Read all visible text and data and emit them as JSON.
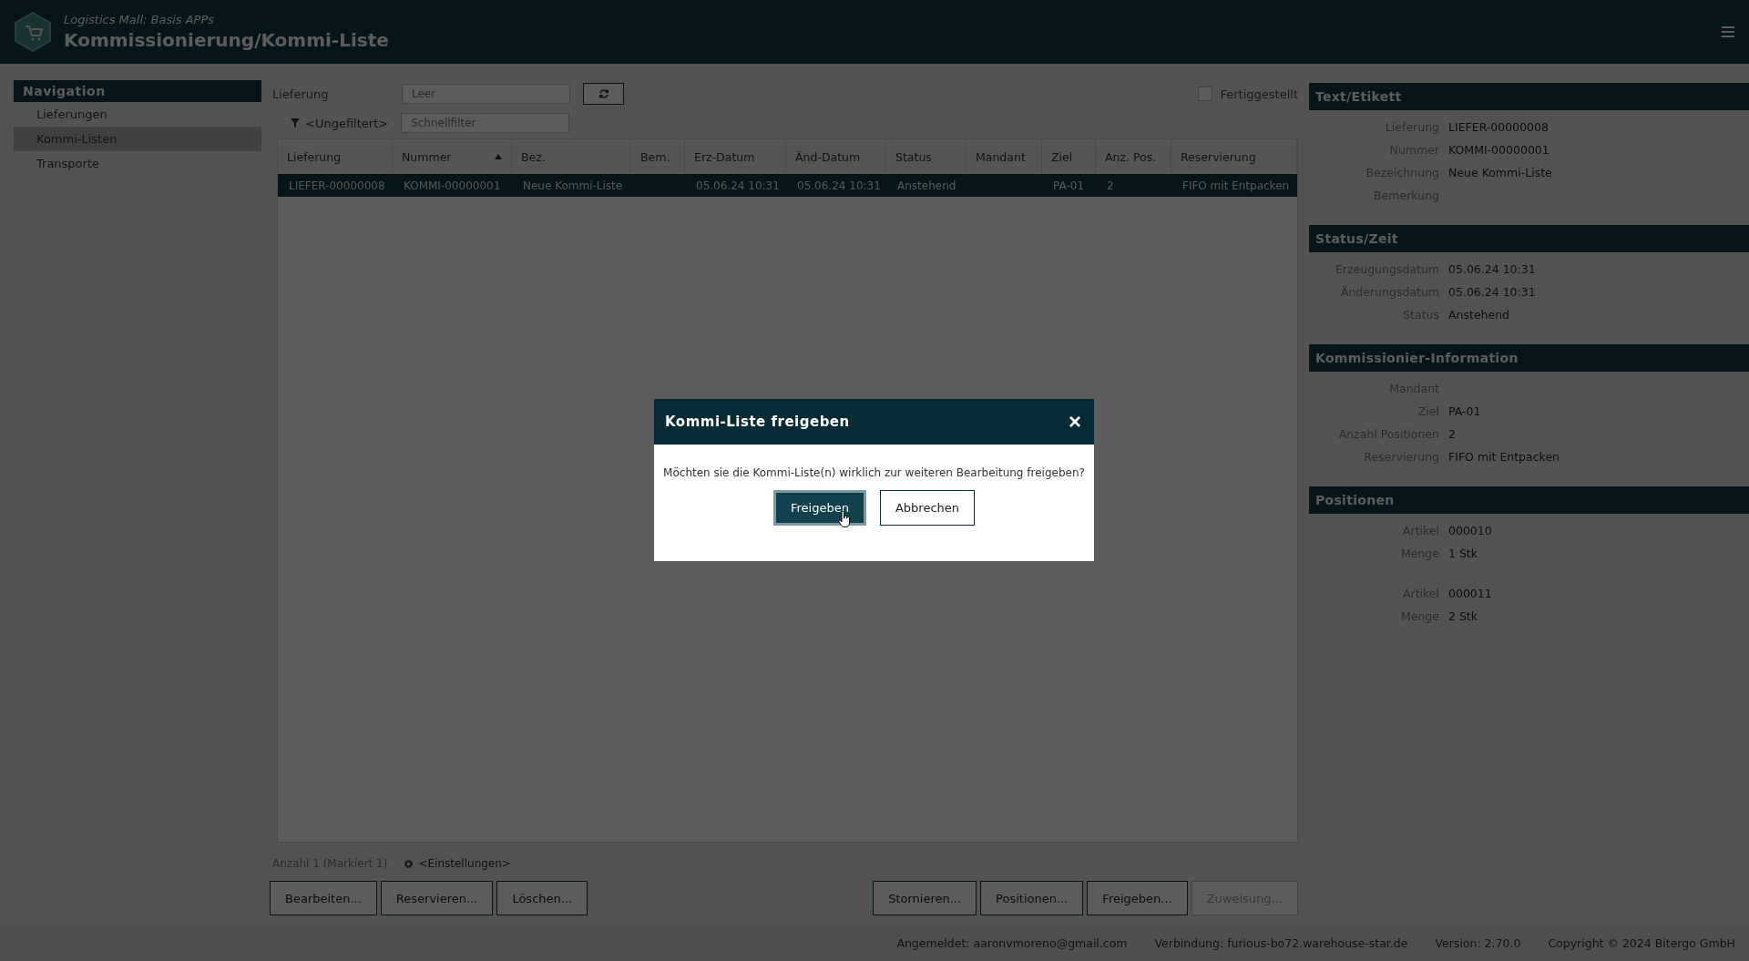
{
  "header": {
    "subtitle": "Logistics Mall: Basis APPs",
    "title": "Kommissionierung/Kommi-Liste"
  },
  "navigation": {
    "title": "Navigation",
    "items": [
      {
        "label": "Lieferungen",
        "selected": false
      },
      {
        "label": "Kommi-Listen",
        "selected": true
      },
      {
        "label": "Transporte",
        "selected": false
      }
    ]
  },
  "delivery_filter": {
    "label": "Lieferung",
    "placeholder": "Leer"
  },
  "finished_checkbox": {
    "label": "Fertiggestellt",
    "checked": false
  },
  "quick_filter": {
    "filter_label": "<Ungefiltert>",
    "placeholder": "Schnellfilter"
  },
  "table": {
    "columns": [
      {
        "label": "Lieferung",
        "sorted": false
      },
      {
        "label": "Nummer",
        "sorted": true
      },
      {
        "label": "Bez.",
        "sorted": false
      },
      {
        "label": "Bem.",
        "sorted": false
      },
      {
        "label": "Erz-Datum",
        "sorted": false
      },
      {
        "label": "Änd-Datum",
        "sorted": false
      },
      {
        "label": "Status",
        "sorted": false
      },
      {
        "label": "Mandant",
        "sorted": false
      },
      {
        "label": "Ziel",
        "sorted": false
      },
      {
        "label": "Anz. Pos.",
        "sorted": false
      },
      {
        "label": "Reservierung",
        "sorted": false
      }
    ],
    "rows": [
      {
        "selected": true,
        "cells": [
          "LIEFER-00000008",
          "KOMMI-00000001",
          "Neue Kommi-Liste",
          "",
          "05.06.24 10:31",
          "05.06.24 10:31",
          "Anstehend",
          "",
          "PA-01",
          "2",
          "FIFO mit Entpacken"
        ]
      }
    ]
  },
  "table_footer": {
    "count": "Anzahl 1 (Markiert 1)",
    "settings": "<Einstellungen>"
  },
  "buttons_left": [
    {
      "label": "Bearbeiten...",
      "disabled": false
    },
    {
      "label": "Reservieren...",
      "disabled": false
    },
    {
      "label": "Löschen...",
      "disabled": false
    }
  ],
  "buttons_right": [
    {
      "label": "Stornieren...",
      "disabled": false
    },
    {
      "label": "Positionen...",
      "disabled": false
    },
    {
      "label": "Freigeben...",
      "disabled": false
    },
    {
      "label": "Zuweisung...",
      "disabled": true
    }
  ],
  "details": [
    {
      "title": "Text/Etikett",
      "groups": [
        [
          {
            "label": "Lieferung",
            "value": "LIEFER-00000008"
          },
          {
            "label": "Nummer",
            "value": "KOMMI-00000001"
          },
          {
            "label": "Bezeichnung",
            "value": "Neue Kommi-Liste"
          },
          {
            "label": "Bemerkung"
          }
        ]
      ]
    },
    {
      "title": "Status/Zeit",
      "groups": [
        [
          {
            "label": "Erzeugungsdatum",
            "value": "05.06.24 10:31"
          },
          {
            "label": "Änderungsdatum",
            "value": "05.06.24 10:31"
          },
          {
            "label": "Status",
            "value": "Anstehend"
          }
        ]
      ]
    },
    {
      "title": "Kommissionier-Information",
      "groups": [
        [
          {
            "label": "Mandant"
          },
          {
            "label": "Ziel",
            "value": "PA-01"
          },
          {
            "label": "Anzahl Positionen",
            "value": "2"
          },
          {
            "label": "Reservierung",
            "value": "FIFO mit Entpacken"
          }
        ]
      ]
    },
    {
      "title": "Positionen",
      "groups": [
        [
          {
            "label": "Artikel",
            "value": "000010"
          },
          {
            "label": "Menge",
            "value": "1 Stk"
          }
        ],
        [
          {
            "label": "Artikel",
            "value": "000011"
          },
          {
            "label": "Menge",
            "value": "2 Stk"
          }
        ]
      ]
    }
  ],
  "status_bar": [
    "Angemeldet: aaronvmoreno@gmail.com",
    "Verbindung: furious-bo72.warehouse-star.de",
    "Version: 2.70.0",
    "Copyright © 2024 Bitergo GmbH"
  ],
  "dialog": {
    "title": "Kommi-Liste freigeben",
    "close": "×",
    "message": "Möchten sie die Kommi-Liste(n) wirklich zur weiteren Bearbeitung freigeben?",
    "buttons": [
      {
        "label": "Freigeben",
        "primary": true
      },
      {
        "label": "Abbrechen",
        "primary": false
      }
    ]
  }
}
